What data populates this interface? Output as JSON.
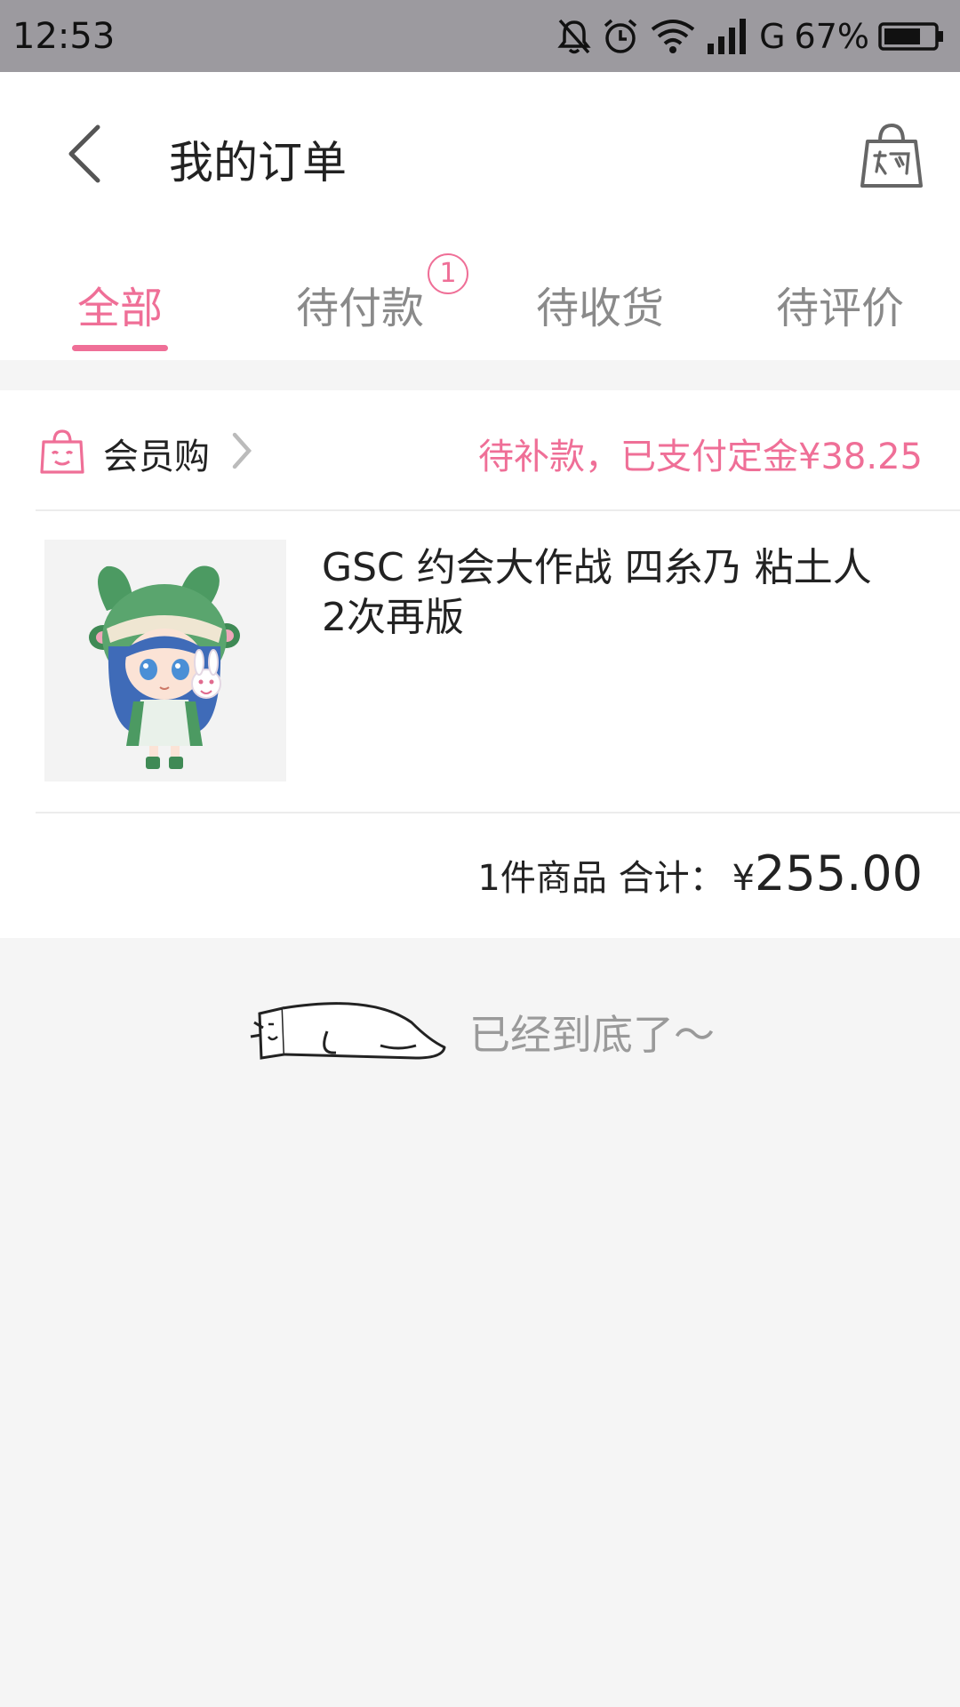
{
  "status_bar": {
    "time": "12:53",
    "network": "G",
    "battery": "67%",
    "icons": [
      "bell-off-icon",
      "alarm-icon",
      "wifi-icon",
      "signal-icon",
      "battery-icon"
    ]
  },
  "header": {
    "title": "我的订单"
  },
  "tabs": [
    {
      "label": "全部",
      "active": true
    },
    {
      "label": "待付款",
      "badge": "1"
    },
    {
      "label": "待收货"
    },
    {
      "label": "待评价"
    }
  ],
  "order": {
    "shop_name": "会员购",
    "status": "待补款，已支付定金¥38.25",
    "product_title": "GSC 约会大作战 四糸乃 粘土人 2次再版",
    "summary_label": "1件商品 合计：",
    "currency": "¥",
    "total": "255.00"
  },
  "footer": {
    "end_text": "已经到底了～"
  },
  "colors": {
    "accent": "#ef6f97",
    "status_bar": "#9c9a9f",
    "background": "#f5f5f5"
  }
}
